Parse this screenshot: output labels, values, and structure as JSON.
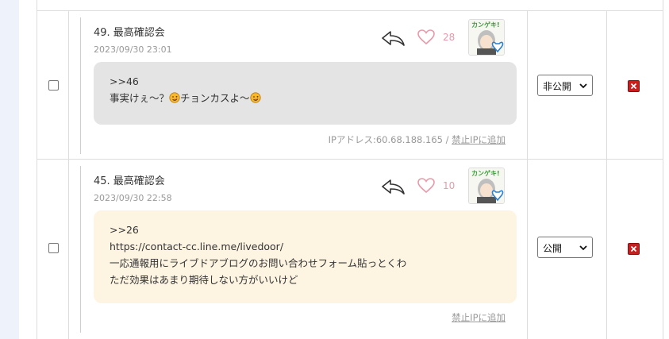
{
  "comments": [
    {
      "title": "49. 最高確認会",
      "date": "2023/09/30 23:01",
      "likes": "28",
      "body_line1": ">>46",
      "body_line2a": "事実けぇ～？",
      "body_line2b": "チョンカスよ～",
      "ip_label": "IPアドレス:60.68.188.165 / ",
      "ban_link": "禁止IPに追加",
      "visibility": "非公開",
      "avatar_text": "カンゲキ!",
      "bubble_color": "#e4e4e4"
    },
    {
      "title": "45. 最高確認会",
      "date": "2023/09/30 22:58",
      "likes": "10",
      "body_line1": ">>26",
      "body_line2": "https://contact-cc.line.me/livedoor/",
      "body_line3": "一応通報用にライブドアブログのお問い合わせフォーム貼っとくわ",
      "body_line4": "ただ効果はあまり期待しない方がいいけど",
      "ban_link": "禁止IPに追加",
      "visibility": "公開",
      "avatar_text": "カンゲキ!",
      "bubble_color": "#fdf4e2"
    }
  ],
  "icons": {
    "reply": "reply-arrow-icon",
    "like": "heart-icon",
    "delete": "delete-x-icon",
    "emoji": "winking-face-emoji-icon"
  },
  "colors": {
    "like": "#e79aa9",
    "delete": "#c81e1e"
  }
}
